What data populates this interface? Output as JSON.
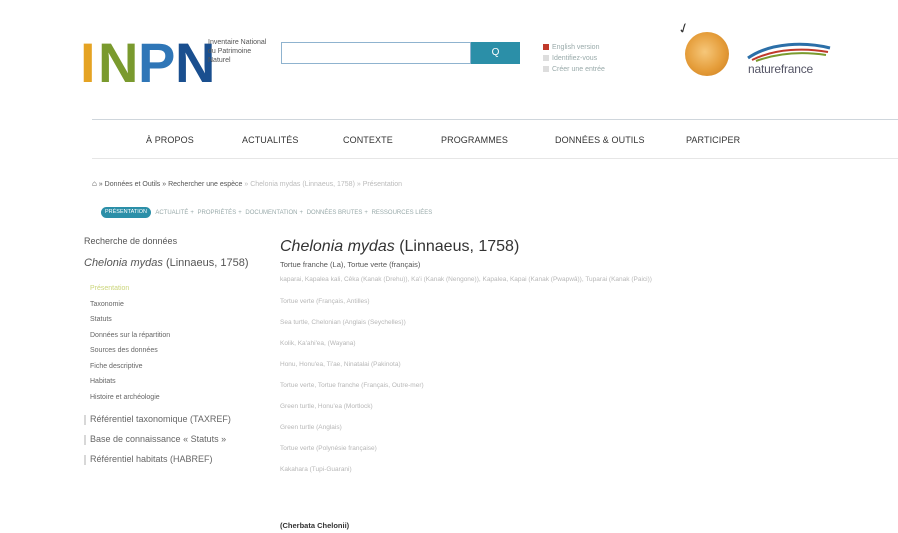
{
  "header": {
    "logo_letters": [
      "I",
      "N",
      "P",
      "N"
    ],
    "logo_subtitle": "Inventaire National du Patrimoine Naturel",
    "search": {
      "placeholder": "",
      "button_label": "Q"
    },
    "account_links": [
      "English version",
      "Identifiez-vous",
      "Créer une entrée"
    ],
    "partner_name": "naturefrance"
  },
  "nav": {
    "items": [
      "À PROPOS",
      "ACTUALITÉS",
      "CONTEXTE",
      "PROGRAMMES",
      "DONNÉES & OUTILS",
      "PARTICIPER"
    ]
  },
  "breadcrumb": {
    "home_icon": "home-icon",
    "items": [
      "Données et Outils",
      "Rechercher une espèce",
      "Chelonia mydas (Linnaeus, 1758)",
      "Présentation"
    ]
  },
  "subnav": {
    "pill": "PRÉSENTATION",
    "items": [
      "ACTUALITÉ",
      "PROPRIÉTÉS",
      "DOCUMENTATION",
      "DONNÉES BRUTES",
      "RESSOURCES LIÉES"
    ]
  },
  "sidebar": {
    "heading": "Recherche de données",
    "species": "Chelonia mydas",
    "species_author": "(Linnaeus, 1758)",
    "items": [
      {
        "label": "Présentation",
        "active": true
      },
      {
        "label": "Taxonomie",
        "active": false
      },
      {
        "label": "Statuts",
        "active": false
      },
      {
        "label": "Données sur la répartition",
        "active": false
      },
      {
        "label": "Sources des données",
        "active": false
      },
      {
        "label": "Fiche descriptive",
        "active": false
      },
      {
        "label": "Habitats",
        "active": false
      },
      {
        "label": "Histoire et archéologie",
        "active": false
      }
    ],
    "sections": [
      "Référentiel taxonomique (TAXREF)",
      "Base de connaissance « Statuts »",
      "Référentiel habitats (HABREF)"
    ]
  },
  "main": {
    "title_species": "Chelonia mydas",
    "title_author": "(Linnaeus, 1758)",
    "vernacular": "Tortue franche (La), Tortue verte (français)",
    "other_names": [
      "kaparai, Kapalea kali, Cêka (Kanak (Drehu)), Ka'i (Kanak (Nengone)), Kapalea, Kapai (Kanak (Pwapwâ)), Tuparai (Kanak (Paici))",
      "Tortue verte (Français, Antilles)",
      "Sea turtle, Chelonian (Anglais (Seychelles))",
      "Kolik, Ka'ahi'ea, (Wayana)",
      "Honu, Honu'ea, Ti'ae, Ninatalai (Pakinota)",
      "Tortue verte, Tortue franche (Français, Outre-mer)",
      "Green turtle, Honu'ea (Mortlock)",
      "Green turtle (Anglais)",
      "Tortue verte (Polynésie française)",
      "Kakahara (Tupi-Guarani)",
      "(Cherbata Chelonii)"
    ],
    "footer_label": "(Cherbata Chelonii)"
  }
}
